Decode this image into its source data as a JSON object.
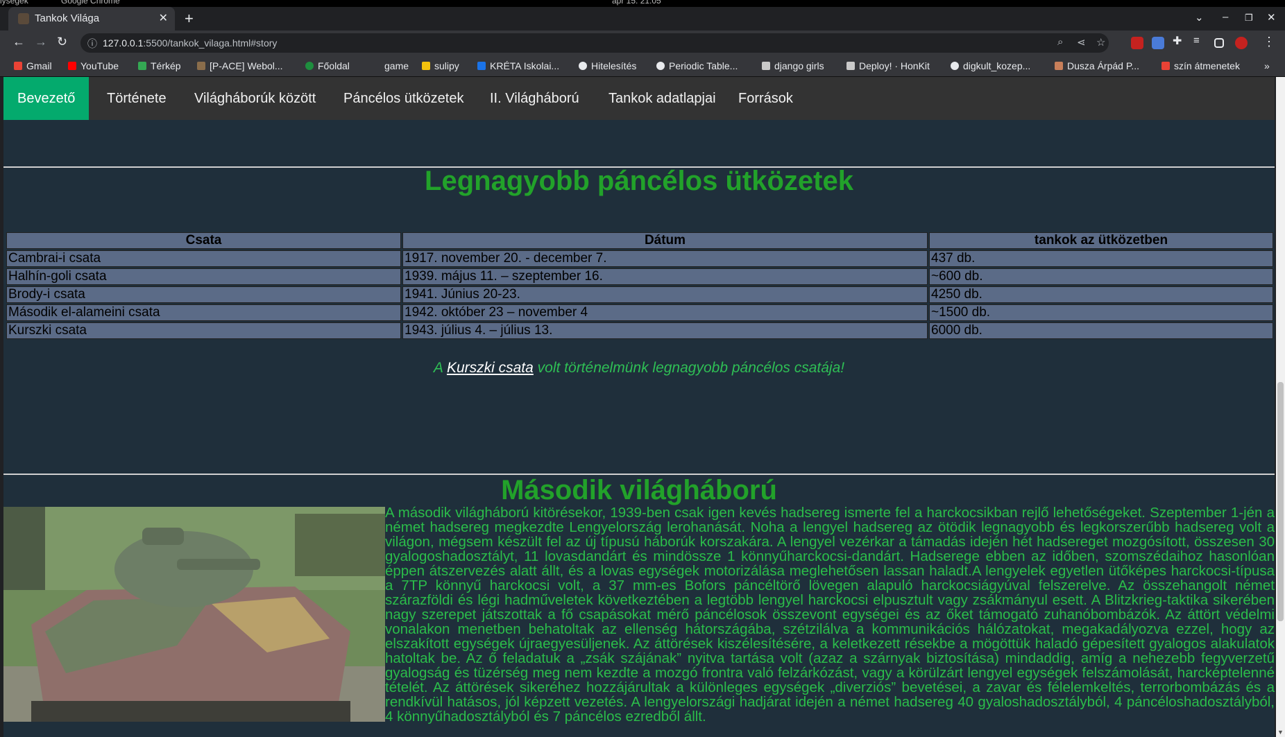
{
  "os_bar": {
    "left_text": "lysegek",
    "app": "Google Chrome",
    "clock": "ápr 15. 21:05"
  },
  "browser": {
    "tab_title": "Tankok Világa",
    "url_host": "127.0.0.1",
    "url_rest": ":5500/tankok_vilaga.html#story",
    "bookmarks": [
      "Gmail",
      "YouTube",
      "Térkép",
      "[P-ACE] Webol...",
      "Főoldal",
      "game",
      "sulipy",
      "KRÉTA Iskolai...",
      "Hitelesítés",
      "Periodic Table...",
      "django girls",
      "Deploy! · HonKit",
      "digkult_kozep...",
      "Dusza Árpád P...",
      "szín átmenetek"
    ],
    "bookmarks_more": "»"
  },
  "site_nav": [
    "Bevezető",
    "Története",
    "Világháborúk között",
    "Páncélos ütközetek",
    "II. Világháború",
    "Tankok adatlapjai",
    "Források"
  ],
  "battles": {
    "title": "Legnagyobb páncélos ütközetek",
    "headers": [
      "Csata",
      "Dátum",
      "tankok az ütközetben"
    ],
    "rows": [
      [
        "Cambrai-i csata",
        "1917. november 20. - december 7.",
        "437 db."
      ],
      [
        "Halhín-goli csata",
        "1939. május 11. – szeptember 16.",
        "~600 db."
      ],
      [
        "Brody-i csata",
        "1941. Június 20-23.",
        "4250 db."
      ],
      [
        "Második el-alameini csata",
        "1942. október 23 – november 4",
        "~1500 db."
      ],
      [
        "Kurszki csata",
        "1943. július 4. – július 13.",
        "6000 db."
      ]
    ],
    "note_prefix": "A ",
    "note_link": "Kurszki csata",
    "note_suffix": " volt történelmünk legnagyobb páncélos csatája!"
  },
  "ww2": {
    "title": "Második világháború",
    "text": "A második világháború kitörésekor, 1939-ben csak igen kevés hadsereg ismerte fel a harckocsikban rejlő lehetőségeket. Szeptember 1-jén a német hadsereg megkezdte Lengyelország lerohanását. Noha a lengyel hadsereg az ötödik legnagyobb és legkorszerűbb hadsereg volt a világon, mégsem készült fel az új típusú háborúk korszakára. A lengyel vezérkar a támadás idején hét hadsereget mozgósított, összesen 30 gyalogoshadosztályt, 11 lovasdandárt és mindössze 1 könnyűharckocsi-dandárt. Hadserege ebben az időben, szomszédaihoz hasonlóan éppen átszervezés alatt állt, és a lovas egységek motorizálása meglehetősen lassan haladt.A lengyelek egyetlen ütőképes harckocsi-típusa a 7TP könnyű harckocsi volt, a 37 mm-es Bofors páncéltörő lövegen alapuló harckocsiágyúval felszerelve. Az összehangolt német szárazföldi és légi hadműveletek következtében a legtöbb lengyel harckocsi elpusztult vagy zsákmányul esett. A Blitzkrieg-taktika sikerében nagy szerepet játszottak a fő csapásokat mérő páncélosok összevont egységei és az őket támogató zuhanóbombázók. Az áttört védelmi vonalakon menetben behatoltak az ellenség hátországába, szétzilálva a kommunikációs hálózatokat, megakadályozva ezzel, hogy az elszakított egységek újraegyesüljenek. Az áttörések kiszélesítésére, a keletkezett résekbe a mögöttük haladó gépesített gyalogos alakulatok hatoltak be. Az ő feladatuk a „zsák szájának” nyitva tartása volt (azaz a szárnyak biztosítása) mindaddig, amíg a nehezebb fegyverzetű gyalogság és tüzérség meg nem kezdte a mozgó frontra való felzárkózást, vagy a körülzárt lengyel egységek felszámolását, harcképtelenné tételét. Az áttörések sikeréhez hozzájárultak a különleges egységek „diverziós” bevetései, a zavar és félelemkeltés, terrorbombázás és a rendkívül hatásos, jól képzett vezetés. A lengyelországi hadjárat idején a német hadsereg 40 gyaloshadosztályból, 4 páncéloshadosztályból, 4 könnyűhadosztályból és 7 páncélos ezredből állt."
  }
}
